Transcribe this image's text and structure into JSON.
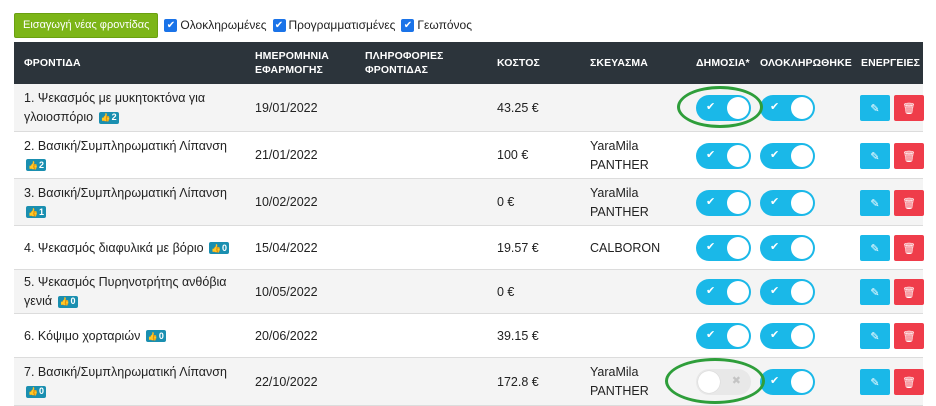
{
  "toolbar": {
    "add_label": "Εισαγωγή νέας φροντίδας",
    "filters": [
      {
        "label": "Ολοκληρωμένες",
        "checked": true
      },
      {
        "label": "Προγραμματισμένες",
        "checked": true
      },
      {
        "label": "Γεωπόνος",
        "checked": true
      }
    ]
  },
  "columns": {
    "care": "ΦΡΟΝΤΙΔΑ",
    "date_line1": "ΗΜΕΡΟΜΗΝΙΑ",
    "date_line2": "ΕΦΑΡΜΟΓΗΣ",
    "info_line1": "ΠΛΗΡΟΦΟΡΙΕΣ",
    "info_line2": "ΦΡΟΝΤΙΔΑΣ",
    "cost": "ΚΟΣΤΟΣ",
    "product": "ΣΚΕΥΑΣΜΑ",
    "public": "ΔΗΜΟΣΙΑ*",
    "completed": "ΟΛΟΚΛΗΡΩΘΗΚΕ",
    "actions": "ΕΝΕΡΓΕΙΕΣ"
  },
  "icons": {
    "check": "✔",
    "cross": "✖",
    "thumb": "👍",
    "edit": "✎",
    "trash": "🗑"
  },
  "rows": [
    {
      "name": "1. Ψεκασμός με μυκητοκτόνα για γλοιοσπόριο",
      "likes": "2",
      "date": "19/01/2022",
      "info": "",
      "cost": "43.25 €",
      "product": "",
      "public": true,
      "completed": true
    },
    {
      "name": "2. Βασική/Συμπληρωματική Λίπανση",
      "likes": "2",
      "date": "21/01/2022",
      "info": "",
      "cost": "100 €",
      "product": "YaraMila PANTHER",
      "public": true,
      "completed": true
    },
    {
      "name": "3. Βασική/Συμπληρωματική Λίπανση",
      "likes": "1",
      "date": "10/02/2022",
      "info": "",
      "cost": "0 €",
      "product": "YaraMila PANTHER",
      "public": true,
      "completed": true
    },
    {
      "name": "4. Ψεκασμός διαφυλικά με βόριο",
      "likes": "0",
      "date": "15/04/2022",
      "info": "",
      "cost": "19.57 €",
      "product": "CALBORON",
      "public": true,
      "completed": true
    },
    {
      "name": "5. Ψεκασμός Πυρηνοτρήτης ανθόβια γενιά",
      "likes": "0",
      "date": "10/05/2022",
      "info": "",
      "cost": "0 €",
      "product": "",
      "public": true,
      "completed": true
    },
    {
      "name": "6. Κόψιμο χορταριών",
      "likes": "0",
      "date": "20/06/2022",
      "info": "",
      "cost": "39.15 €",
      "product": "",
      "public": true,
      "completed": true
    },
    {
      "name": "7. Βασική/Συμπληρωματική Λίπανση",
      "likes": "0",
      "date": "22/10/2022",
      "info": "",
      "cost": "172.8 €",
      "product": "YaraMila PANTHER",
      "public": false,
      "completed": true
    }
  ],
  "colors": {
    "add_button": "#7cb518",
    "header_bg": "#2c343b",
    "toggle_on": "#1ab8e8",
    "edit_button": "#1ab8e8",
    "delete_button": "#ef3c4a",
    "highlight_ring": "#2e9e3a"
  }
}
